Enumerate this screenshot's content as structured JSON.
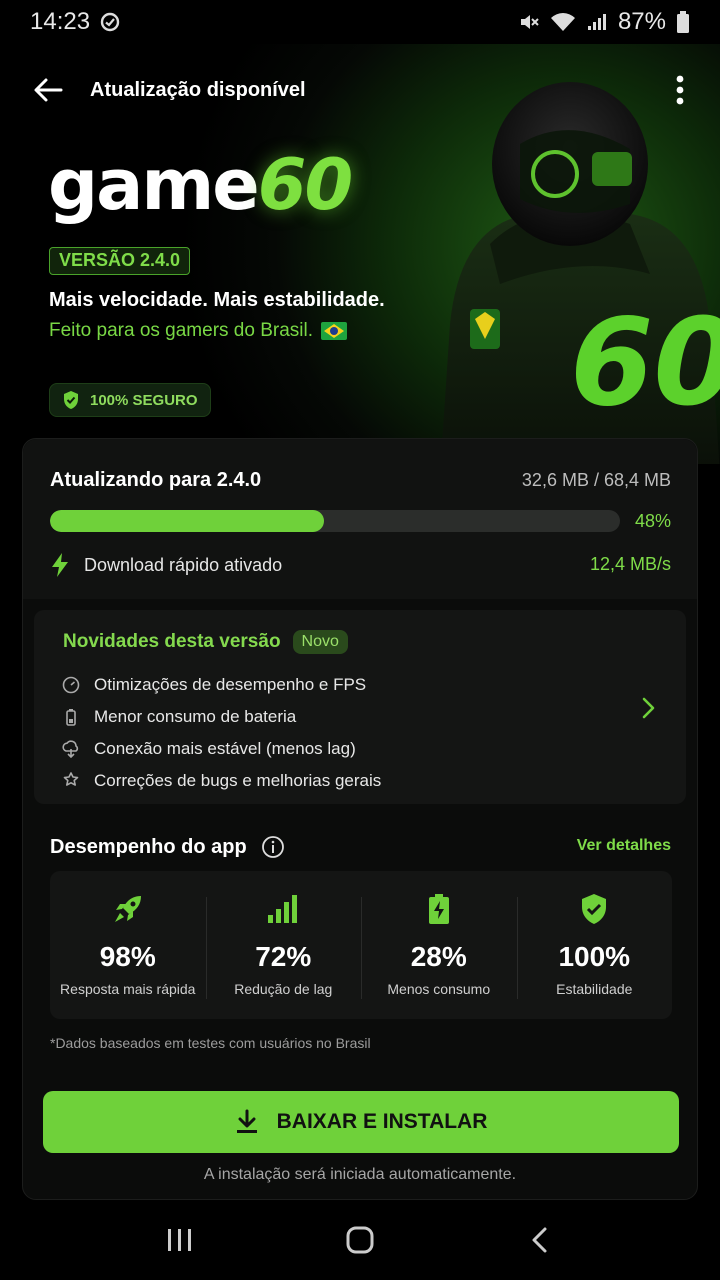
{
  "status_bar": {
    "time": "14:23",
    "battery": "87%"
  },
  "app_bar": {
    "title": "Atualização disponível"
  },
  "hero": {
    "brand_white": "game",
    "brand_green": "60",
    "version": "VERSÃO 2.4.0",
    "tagline": "Mais velocidade. Mais estabilidade.",
    "subtagline": "Feito para os gamers do Brasil.",
    "secure_badge": "100% SEGURO",
    "jacket_number": "60"
  },
  "download": {
    "title": "Atualizando para 2.4.0",
    "size": "32,6 MB / 68,4 MB",
    "progress": 0.48,
    "percent": "48%",
    "fast_label": "Download rápido ativado",
    "speed": "12,4 MB/s"
  },
  "news": {
    "title": "Novidades desta versão",
    "badge": "Novo",
    "items": [
      {
        "icon": "speedometer-icon",
        "label": "Otimizações de desempenho e FPS"
      },
      {
        "icon": "battery-icon",
        "label": "Menor consumo de bateria"
      },
      {
        "icon": "cloud-signal-icon",
        "label": "Conexão mais estável (menos lag)"
      },
      {
        "icon": "settings-star-icon",
        "label": "Correções de bugs e melhorias gerais"
      }
    ]
  },
  "performance": {
    "title": "Desempenho do app",
    "link": "Ver detalhes",
    "stats": [
      {
        "icon": "rocket-icon",
        "value": "98%",
        "label": "Resposta mais rápida"
      },
      {
        "icon": "signal-bars-icon",
        "value": "72%",
        "label": "Redução de lag"
      },
      {
        "icon": "battery-charging-icon",
        "value": "28%",
        "label": "Menos consumo"
      },
      {
        "icon": "shield-check-icon",
        "value": "100%",
        "label": "Estabilidade"
      }
    ],
    "footnote": "*Dados baseados em testes com usuários no Brasil"
  },
  "cta": {
    "label": "BAIXAR E INSTALAR",
    "note": "A instalação será iniciada automaticamente."
  },
  "colors": {
    "accent": "#6fd13a",
    "background": "#000000",
    "card": "#111211"
  }
}
